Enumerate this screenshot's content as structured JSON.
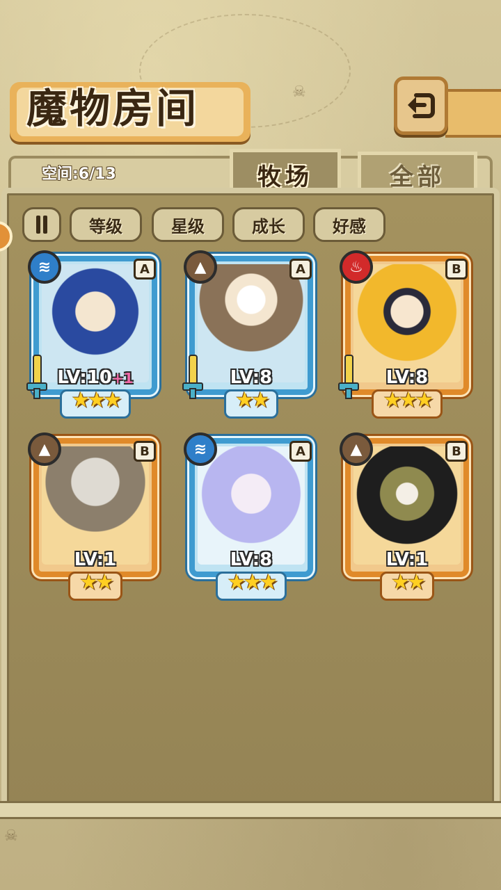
{
  "title": "魔物房间",
  "space": "空间:6/13",
  "tabs": [
    {
      "label": "牧场",
      "active": true
    },
    {
      "label": "全部",
      "active": false
    }
  ],
  "sort_buttons": [
    "等级",
    "星级",
    "成长",
    "好感"
  ],
  "monsters": [
    {
      "grade": "A",
      "element": "water-icon",
      "level": "LV:10",
      "bonus": "+1",
      "stars": 3,
      "sword": true
    },
    {
      "grade": "A",
      "element": "earth-icon",
      "level": "LV:8",
      "bonus": "",
      "stars": 2,
      "sword": true
    },
    {
      "grade": "B",
      "element": "fire-icon",
      "level": "LV:8",
      "bonus": "",
      "stars": 3,
      "sword": true
    },
    {
      "grade": "B",
      "element": "earth-icon",
      "level": "LV:1",
      "bonus": "",
      "stars": 2,
      "sword": false
    },
    {
      "grade": "A",
      "element": "water-icon",
      "level": "LV:8",
      "bonus": "",
      "stars": 3,
      "sword": false
    },
    {
      "grade": "B",
      "element": "earth-icon",
      "level": "LV:1",
      "bonus": "",
      "stars": 2,
      "sword": false
    }
  ],
  "colors": {
    "grade_a_frame": "#3f9bd0",
    "grade_b_frame": "#e08a2a",
    "panel": "#a4925f",
    "star": "#ffcf22"
  }
}
